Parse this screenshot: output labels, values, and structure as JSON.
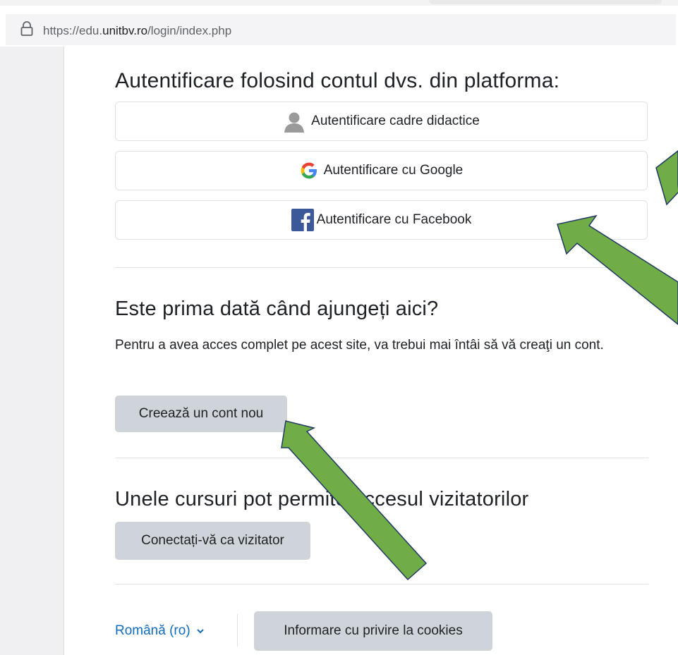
{
  "browser": {
    "url_prefix": "https://edu.",
    "url_domain": "unitbv.ro",
    "url_path": "/login/index.php"
  },
  "login": {
    "platform_heading": "Autentificare folosind contul dvs. din platforma:",
    "idp_buttons": [
      {
        "label": "Autentificare cadre didactice",
        "icon": "user-avatar-icon"
      },
      {
        "label": "Autentificare cu Google",
        "icon": "google-icon"
      },
      {
        "label": "Autentificare cu Facebook",
        "icon": "facebook-icon"
      }
    ],
    "first_time_heading": "Este prima dată când ajungeți aici?",
    "first_time_text": "Pentru a avea acces complet pe acest site, va trebui mai întâi să vă creaţi un cont.",
    "create_account_label": "Creează un cont nou",
    "guest_heading": "Unele cursuri pot permite accesul vizitatorilor",
    "guest_button_label": "Conectați-vă ca vizitator"
  },
  "footer": {
    "language": "Română (ro)",
    "cookies_label": "Informare cu privire la cookies"
  },
  "colors": {
    "arrow_fill": "#70ad47",
    "arrow_stroke": "#1f3864",
    "link": "#0f6cbf",
    "secondary_button": "#ced4da"
  }
}
